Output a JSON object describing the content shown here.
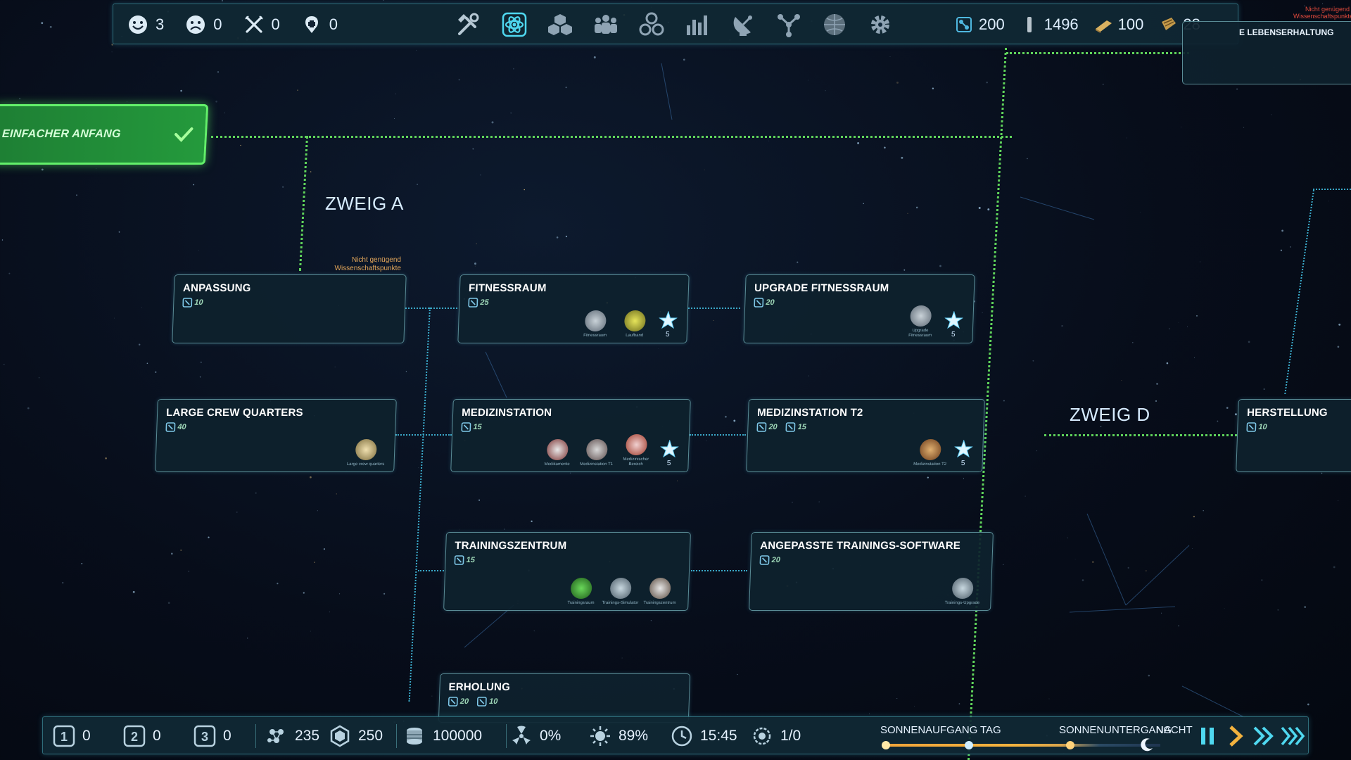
{
  "top_bar": {
    "counters": [
      {
        "icon": "happy-face-icon",
        "value": "3"
      },
      {
        "icon": "sad-face-icon",
        "value": "0"
      },
      {
        "icon": "food-utensils-icon",
        "value": "0"
      },
      {
        "icon": "medical-bandage-icon",
        "value": "0"
      }
    ],
    "tools": [
      {
        "icon": "build-tools-icon",
        "name": "build"
      },
      {
        "icon": "research-atom-icon",
        "name": "research"
      },
      {
        "icon": "storage-crates-icon",
        "name": "storage"
      },
      {
        "icon": "crew-icon",
        "name": "crew"
      },
      {
        "icon": "modules-icon",
        "name": "modules"
      },
      {
        "icon": "statistics-icon",
        "name": "statistics"
      },
      {
        "icon": "satellite-dish-icon",
        "name": "communication"
      },
      {
        "icon": "network-icon",
        "name": "network"
      },
      {
        "icon": "globe-map-icon",
        "name": "map"
      },
      {
        "icon": "settings-gear-icon",
        "name": "settings"
      }
    ],
    "resources": [
      {
        "icon": "research-points-icon",
        "value": "200"
      },
      {
        "icon": "titanium-bar-icon",
        "value": "1496"
      },
      {
        "icon": "gold-ingot-icon",
        "value": "100"
      },
      {
        "icon": "supplies-crate-icon",
        "value": "28"
      }
    ]
  },
  "tree": {
    "start": {
      "title": "EINFACHER ANFANG"
    },
    "branch_a": "ZWEIG A",
    "branch_d": "ZWEIG D",
    "warning": "Nicht genügend Wissenschaftspunkte",
    "corner_warning": "Nicht genügend Wissenschaftspunkte",
    "top_right_node": "E LEBENSERHALTUNG",
    "nodes": [
      {
        "id": "anpassung",
        "title": "ANPASSUNG",
        "costs": [
          "10"
        ],
        "unlocks": [],
        "stars": null
      },
      {
        "id": "fitnessraum",
        "title": "FITNESSRAUM",
        "costs": [
          "25"
        ],
        "unlocks": [
          {
            "cap": "Fitnessraum"
          },
          {
            "cap": "Laufband"
          }
        ],
        "stars": "5"
      },
      {
        "id": "upgrade-fitnessraum",
        "title": "UPGRADE FITNESSRAUM",
        "costs": [
          "20"
        ],
        "unlocks": [
          {
            "cap": "Upgrade Fitnessraum"
          }
        ],
        "stars": "5"
      },
      {
        "id": "large-crew-quarters",
        "title": "LARGE CREW QUARTERS",
        "costs": [
          "40"
        ],
        "unlocks": [
          {
            "cap": "Large crew quarters"
          }
        ],
        "stars": null
      },
      {
        "id": "medizinstation",
        "title": "MEDIZINSTATION",
        "costs": [
          "15"
        ],
        "unlocks": [
          {
            "cap": "Medikamente"
          },
          {
            "cap": "Medizinstation T1"
          },
          {
            "cap": "Medizinischer Bereich"
          }
        ],
        "stars": "5"
      },
      {
        "id": "medizinstation-t2",
        "title": "MEDIZINSTATION T2",
        "costs": [
          "20",
          "15"
        ],
        "unlocks": [
          {
            "cap": "Medizinstation T2"
          }
        ],
        "stars": "5"
      },
      {
        "id": "trainingszentrum",
        "title": "TRAININGSZENTRUM",
        "costs": [
          "15"
        ],
        "unlocks": [
          {
            "cap": "Trainingsraum"
          },
          {
            "cap": "Trainings-Simulator"
          },
          {
            "cap": "Trainingszentrum"
          }
        ],
        "stars": null
      },
      {
        "id": "trainings-software",
        "title": "ANGEPASSTE TRAININGS-SOFTWARE",
        "costs": [
          "20"
        ],
        "unlocks": [
          {
            "cap": "Trainings-Upgrade"
          }
        ],
        "stars": null
      },
      {
        "id": "herstellung",
        "title": "HERSTELLUNG",
        "costs": [
          "10"
        ],
        "unlocks": [],
        "stars": null
      },
      {
        "id": "erholung",
        "title": "ERHOLUNG",
        "costs": [
          "20",
          "10"
        ],
        "unlocks": [],
        "stars": null
      }
    ]
  },
  "bottom_bar": {
    "slots": [
      {
        "icon": "research-slot-1-icon",
        "value": "0"
      },
      {
        "icon": "research-slot-2-icon",
        "value": "0"
      },
      {
        "icon": "research-slot-3-icon",
        "value": "0"
      }
    ],
    "stats": [
      {
        "icon": "molecules-icon",
        "value": "235"
      },
      {
        "icon": "hexagon-capacity-icon",
        "value": "250"
      },
      {
        "icon": "coin-stack-icon",
        "value": "100000"
      },
      {
        "icon": "radiation-icon",
        "value": "0%"
      },
      {
        "icon": "sun-energy-icon",
        "value": "89%"
      },
      {
        "icon": "clock-icon",
        "value": "15:45"
      },
      {
        "icon": "sol-cycle-icon",
        "value": "1/0"
      }
    ],
    "day_cycle": {
      "sunrise": "SONNENAUFGANG",
      "day": "TAG",
      "sunset": "SONNENUNTERGANG",
      "night": "NACHT"
    },
    "speed_controls": [
      {
        "icon": "pause-icon",
        "name": "pause"
      },
      {
        "icon": "play-icon",
        "name": "normal-speed"
      },
      {
        "icon": "fast-forward-icon",
        "name": "fast-speed"
      },
      {
        "icon": "fastest-forward-icon",
        "name": "fastest-speed"
      }
    ]
  },
  "colors": {
    "accent_green": "#5fd35a",
    "accent_cyan": "#4fd8f0",
    "node_bg": "#0e222e",
    "warning_orange": "#e2a65a"
  }
}
